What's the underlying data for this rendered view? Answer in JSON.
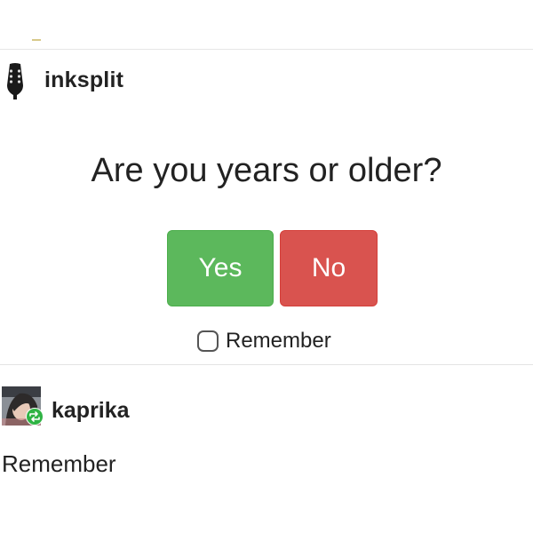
{
  "post": {
    "username": "inksplit",
    "avatar_icon": "guitar-headstock-icon",
    "dialog": {
      "question": "Are you years or older?",
      "yes_label": "Yes",
      "no_label": "No",
      "remember_label": "Remember",
      "remember_checked": false,
      "colors": {
        "yes": "#5cb85c",
        "no": "#d9534f"
      }
    }
  },
  "reblog": {
    "username": "kaprika",
    "avatar_icon": "user-photo-avatar-icon",
    "reblog_badge_icon": "reblog-icon",
    "badge_color": "#2fb344",
    "text": "Remember"
  }
}
